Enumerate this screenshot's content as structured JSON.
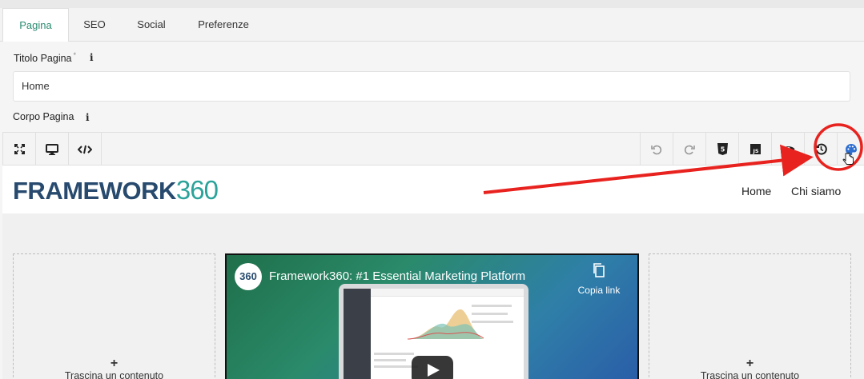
{
  "tabs": [
    {
      "label": "Pagina",
      "active": true
    },
    {
      "label": "SEO",
      "active": false
    },
    {
      "label": "Social",
      "active": false
    },
    {
      "label": "Preferenze",
      "active": false
    }
  ],
  "form": {
    "title_label": "Titolo Pagina",
    "title_required": "*",
    "info_symbol": "i",
    "title_value": "Home",
    "body_label": "Corpo Pagina"
  },
  "toolbar": {
    "left_icons": [
      "fullscreen-icon",
      "desktop-icon",
      "code-icon"
    ],
    "right_icons": [
      "undo-icon",
      "redo-icon",
      "html5-icon",
      "js-icon",
      "eye-icon",
      "history-icon",
      "palette-icon"
    ],
    "js_text": "JS",
    "html_text": "5"
  },
  "site": {
    "logo_word": "FRAMEWORK",
    "logo_num": "360",
    "nav": [
      "Home",
      "Chi siamo"
    ]
  },
  "dropzone": {
    "plus": "+",
    "text": "Trascina un contenuto"
  },
  "video": {
    "badge": "360",
    "title": "Framework360: #1 Essential Marketing Platform",
    "copy_link": "Copia link"
  },
  "annotation": {
    "color": "#e8231f"
  }
}
